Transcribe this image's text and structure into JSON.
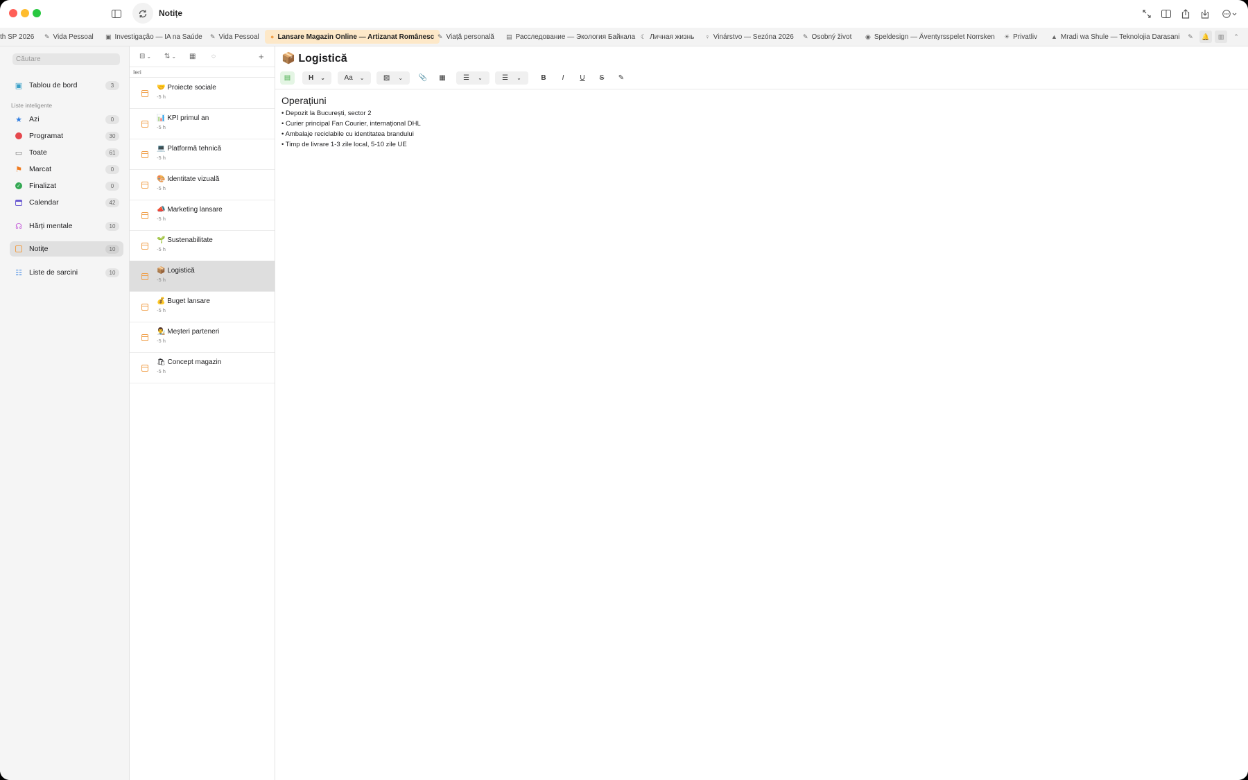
{
  "app": {
    "title": "Notițe"
  },
  "tabs": [
    {
      "label": "th SP 2026",
      "icon": ""
    },
    {
      "label": "Vida Pessoal",
      "icon": "✎"
    },
    {
      "label": "Investigação — IA na Saúde",
      "icon": "▣"
    },
    {
      "label": "Vida Pessoal",
      "icon": "✎"
    },
    {
      "label": "Lansare Magazin Online — Artizanat Românesc",
      "icon": "●"
    },
    {
      "label": "Viață personală",
      "icon": "✎"
    },
    {
      "label": "Расследование — Экология Байкала",
      "icon": "▤"
    },
    {
      "label": "Личная жизнь",
      "icon": "☾"
    },
    {
      "label": "Vinárstvo — Sezóna 2026",
      "icon": "♀"
    },
    {
      "label": "Osobný život",
      "icon": "✎"
    },
    {
      "label": "Speldesign — Äventyrsspelet Norrsken",
      "icon": "◉"
    },
    {
      "label": "Privatliv",
      "icon": "☀"
    },
    {
      "label": "Mradi wa Shule — Teknolojia Darasani",
      "icon": "▲"
    }
  ],
  "sidebar": {
    "search_placeholder": "Căutare",
    "dashboard": {
      "label": "Tablou de bord",
      "count": "3"
    },
    "smart_lists_title": "Liste inteligente",
    "smart": [
      {
        "label": "Azi",
        "count": "0"
      },
      {
        "label": "Programat",
        "count": "30"
      },
      {
        "label": "Toate",
        "count": "61"
      },
      {
        "label": "Marcat",
        "count": "0"
      },
      {
        "label": "Finalizat",
        "count": "0"
      },
      {
        "label": "Calendar",
        "count": "42"
      }
    ],
    "mindmaps": {
      "label": "Hărți mentale",
      "count": "10"
    },
    "notes": {
      "label": "Notițe",
      "count": "10"
    },
    "tasklists": {
      "label": "Liste de sarcini",
      "count": "10"
    }
  },
  "notelist": {
    "group_label": "Ieri",
    "notes": [
      {
        "emoji": "🤝",
        "title": "Proiecte sociale",
        "time": "-5 h"
      },
      {
        "emoji": "📊",
        "title": "KPI primul an",
        "time": "-5 h"
      },
      {
        "emoji": "💻",
        "title": "Platformă tehnică",
        "time": "-5 h"
      },
      {
        "emoji": "🎨",
        "title": "Identitate vizuală",
        "time": "-5 h"
      },
      {
        "emoji": "📣",
        "title": "Marketing lansare",
        "time": "-5 h"
      },
      {
        "emoji": "🌱",
        "title": "Sustenabilitate",
        "time": "-5 h"
      },
      {
        "emoji": "📦",
        "title": "Logistică",
        "time": "-5 h"
      },
      {
        "emoji": "💰",
        "title": "Buget lansare",
        "time": "-5 h"
      },
      {
        "emoji": "👨‍🎨",
        "title": "Meșteri parteneri",
        "time": "-5 h"
      },
      {
        "emoji": "🛍",
        "title": "Concept magazin",
        "time": "-5 h"
      }
    ]
  },
  "editor": {
    "emoji": "📦",
    "title": "Logistică",
    "heading_btn": "H",
    "font_btn": "Aa",
    "bold": "B",
    "italic": "I",
    "underline": "U",
    "strike": "S",
    "section_heading": "Operațiuni",
    "bullets": [
      "• Depozit la București, sector 2",
      "• Curier principal Fan Courier, internațional DHL",
      "• Ambalaje reciclabile cu identitatea brandului",
      "• Timp de livrare 1-3 zile local, 5-10 zile UE"
    ]
  },
  "colors": {
    "accent": "#f0a04b",
    "active_tab_bg": "#fde8c8"
  }
}
